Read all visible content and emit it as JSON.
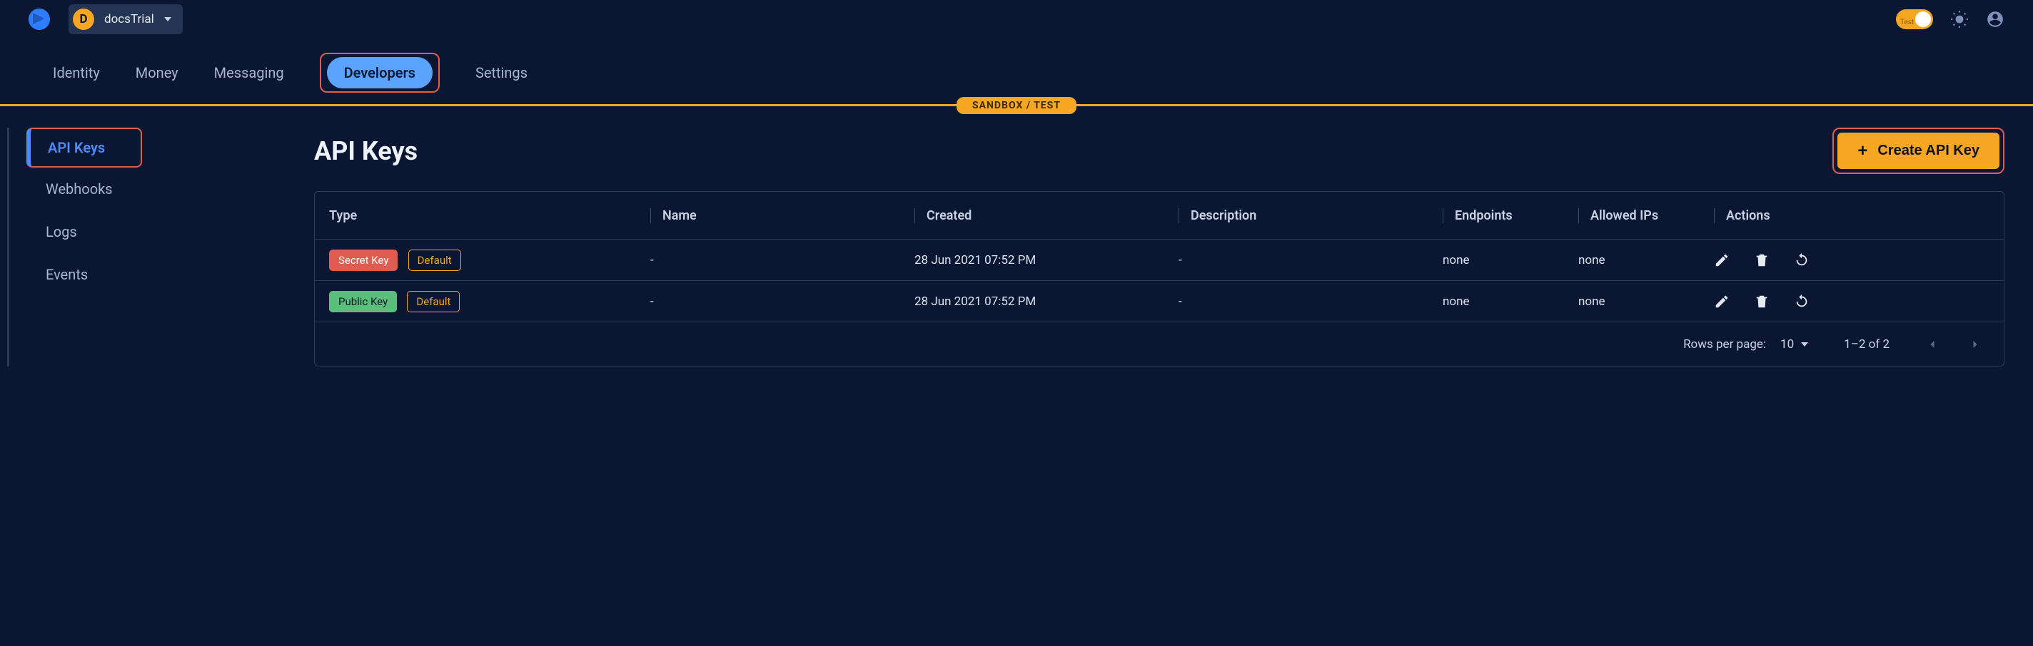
{
  "project": {
    "initial": "D",
    "name": "docsTrial"
  },
  "env_toggle_label": "Test",
  "nav": {
    "items": [
      "Identity",
      "Money",
      "Messaging",
      "Developers",
      "Settings"
    ],
    "active_index": 3
  },
  "env_banner": "SANDBOX / TEST",
  "sidebar": {
    "items": [
      "API Keys",
      "Webhooks",
      "Logs",
      "Events"
    ],
    "active_index": 0
  },
  "page": {
    "title": "API Keys"
  },
  "create_button": "Create API Key",
  "table": {
    "headers": [
      "Type",
      "Name",
      "Created",
      "Description",
      "Endpoints",
      "Allowed IPs",
      "Actions"
    ],
    "rows": [
      {
        "type_badge": "Secret Key",
        "type_variant": "secret",
        "scope_badge": "Default",
        "name": "-",
        "created": "28 Jun 2021 07:52 PM",
        "description": "-",
        "endpoints": "none",
        "allowed_ips": "none"
      },
      {
        "type_badge": "Public Key",
        "type_variant": "public",
        "scope_badge": "Default",
        "name": "-",
        "created": "28 Jun 2021 07:52 PM",
        "description": "-",
        "endpoints": "none",
        "allowed_ips": "none"
      }
    ]
  },
  "pagination": {
    "rows_per_page_label": "Rows per page:",
    "rows_per_page_value": "10",
    "range": "1–2 of 2"
  }
}
